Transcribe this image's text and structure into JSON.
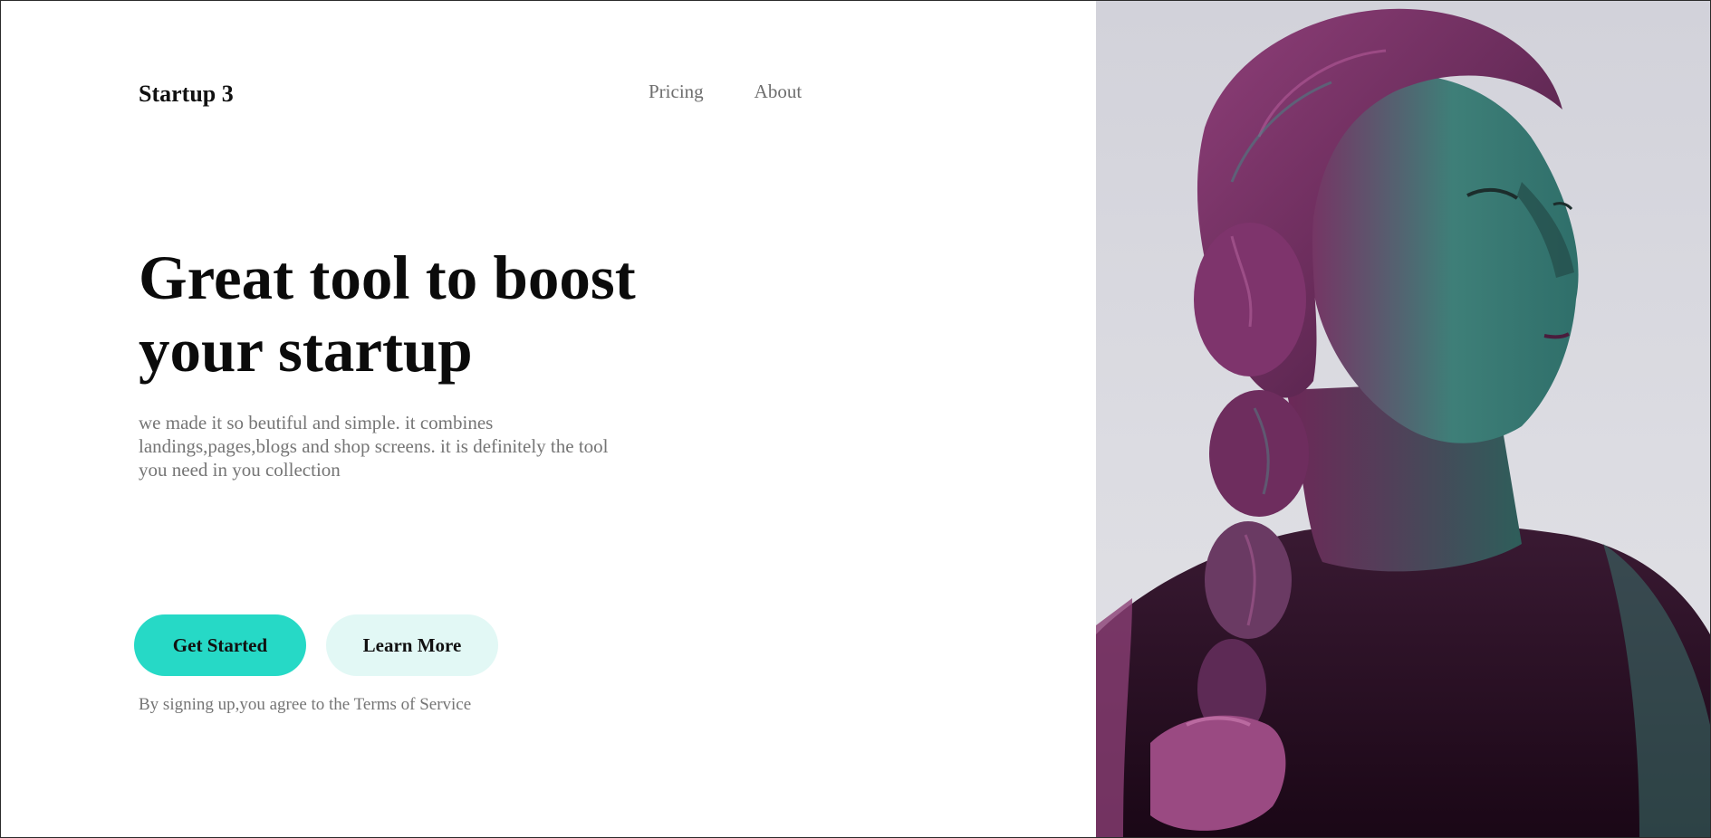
{
  "brand": {
    "logo": "Startup 3"
  },
  "nav": {
    "items": [
      {
        "label": "Pricing"
      },
      {
        "label": "About"
      }
    ]
  },
  "hero": {
    "headline": "Great tool to boost your startup",
    "description": "we made it so beutiful and simple. it combines landings,pages,blogs and shop screens. it is definitely the tool you need in you collection",
    "primary_button": "Get Started",
    "secondary_button": "Learn More",
    "terms": "By signing up,you agree to the Terms of Service"
  },
  "colors": {
    "accent": "#26d9c6",
    "accent_light": "#e2f8f5",
    "text_primary": "#0b0b0b",
    "text_muted": "#757575"
  },
  "image": {
    "subject": "portrait-photo"
  }
}
